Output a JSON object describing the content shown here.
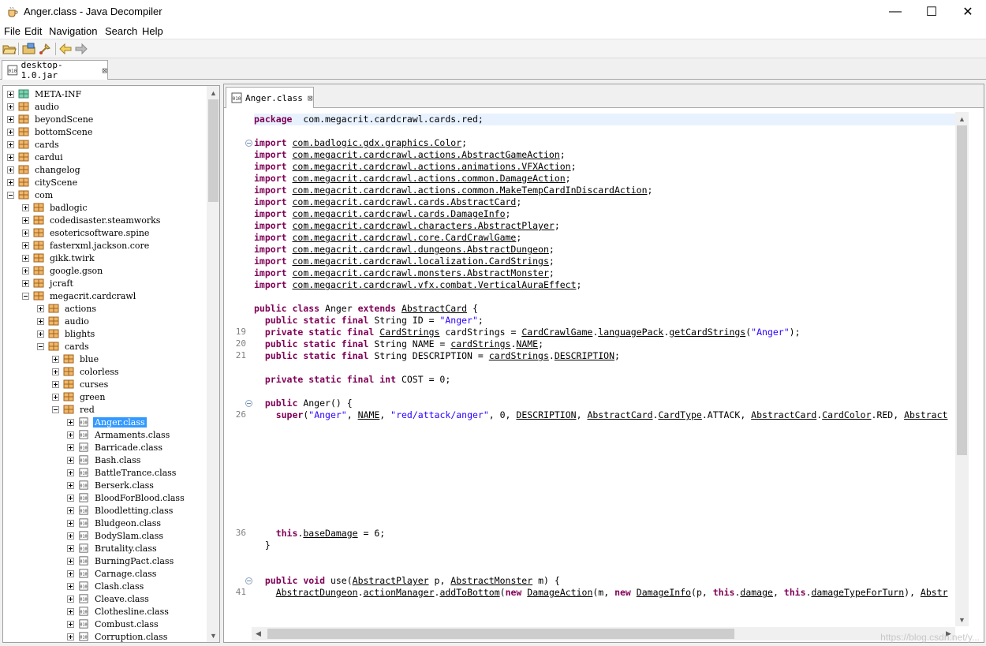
{
  "window": {
    "title": "Anger.class - Java Decompiler",
    "controls": {
      "minimize": "—",
      "maximize": "☐",
      "close": "✕"
    }
  },
  "menu": [
    "File",
    "Edit",
    "Navigation",
    "Search",
    "Help"
  ],
  "toolbar": [
    "open-file-icon",
    "open-folder-icon",
    "search-type-icon",
    "back-arrow-icon",
    "forward-arrow-icon"
  ],
  "outer_tab": {
    "label": "desktop-1.0.jar",
    "close": "⊠"
  },
  "editor_tab": {
    "label": "Anger.class",
    "close": "⊠"
  },
  "tree": [
    {
      "label": "META-INF",
      "indent": 0,
      "kind": "pkg-green",
      "exp": "plus"
    },
    {
      "label": "audio",
      "indent": 0,
      "kind": "pkg",
      "exp": "plus"
    },
    {
      "label": "beyondScene",
      "indent": 0,
      "kind": "pkg",
      "exp": "plus"
    },
    {
      "label": "bottomScene",
      "indent": 0,
      "kind": "pkg",
      "exp": "plus"
    },
    {
      "label": "cards",
      "indent": 0,
      "kind": "pkg",
      "exp": "plus"
    },
    {
      "label": "cardui",
      "indent": 0,
      "kind": "pkg",
      "exp": "plus"
    },
    {
      "label": "changelog",
      "indent": 0,
      "kind": "pkg",
      "exp": "plus"
    },
    {
      "label": "cityScene",
      "indent": 0,
      "kind": "pkg",
      "exp": "plus"
    },
    {
      "label": "com",
      "indent": 0,
      "kind": "pkg",
      "exp": "minus"
    },
    {
      "label": "badlogic",
      "indent": 1,
      "kind": "pkg",
      "exp": "plus"
    },
    {
      "label": "codedisaster.steamworks",
      "indent": 1,
      "kind": "pkg",
      "exp": "plus"
    },
    {
      "label": "esotericsoftware.spine",
      "indent": 1,
      "kind": "pkg",
      "exp": "plus"
    },
    {
      "label": "fasterxml.jackson.core",
      "indent": 1,
      "kind": "pkg",
      "exp": "plus"
    },
    {
      "label": "gikk.twirk",
      "indent": 1,
      "kind": "pkg",
      "exp": "plus"
    },
    {
      "label": "google.gson",
      "indent": 1,
      "kind": "pkg",
      "exp": "plus"
    },
    {
      "label": "jcraft",
      "indent": 1,
      "kind": "pkg",
      "exp": "plus"
    },
    {
      "label": "megacrit.cardcrawl",
      "indent": 1,
      "kind": "pkg",
      "exp": "minus"
    },
    {
      "label": "actions",
      "indent": 2,
      "kind": "pkg",
      "exp": "plus"
    },
    {
      "label": "audio",
      "indent": 2,
      "kind": "pkg",
      "exp": "plus"
    },
    {
      "label": "blights",
      "indent": 2,
      "kind": "pkg",
      "exp": "plus"
    },
    {
      "label": "cards",
      "indent": 2,
      "kind": "pkg",
      "exp": "minus"
    },
    {
      "label": "blue",
      "indent": 3,
      "kind": "pkg",
      "exp": "plus"
    },
    {
      "label": "colorless",
      "indent": 3,
      "kind": "pkg",
      "exp": "plus"
    },
    {
      "label": "curses",
      "indent": 3,
      "kind": "pkg",
      "exp": "plus"
    },
    {
      "label": "green",
      "indent": 3,
      "kind": "pkg",
      "exp": "plus"
    },
    {
      "label": "red",
      "indent": 3,
      "kind": "pkg",
      "exp": "minus"
    },
    {
      "label": "Anger.class",
      "indent": 4,
      "kind": "class",
      "exp": "plus",
      "selected": true
    },
    {
      "label": "Armaments.class",
      "indent": 4,
      "kind": "class",
      "exp": "plus"
    },
    {
      "label": "Barricade.class",
      "indent": 4,
      "kind": "class",
      "exp": "plus"
    },
    {
      "label": "Bash.class",
      "indent": 4,
      "kind": "class",
      "exp": "plus"
    },
    {
      "label": "BattleTrance.class",
      "indent": 4,
      "kind": "class",
      "exp": "plus"
    },
    {
      "label": "Berserk.class",
      "indent": 4,
      "kind": "class",
      "exp": "plus"
    },
    {
      "label": "BloodForBlood.class",
      "indent": 4,
      "kind": "class",
      "exp": "plus"
    },
    {
      "label": "Bloodletting.class",
      "indent": 4,
      "kind": "class",
      "exp": "plus"
    },
    {
      "label": "Bludgeon.class",
      "indent": 4,
      "kind": "class",
      "exp": "plus"
    },
    {
      "label": "BodySlam.class",
      "indent": 4,
      "kind": "class",
      "exp": "plus"
    },
    {
      "label": "Brutality.class",
      "indent": 4,
      "kind": "class",
      "exp": "plus"
    },
    {
      "label": "BurningPact.class",
      "indent": 4,
      "kind": "class",
      "exp": "plus"
    },
    {
      "label": "Carnage.class",
      "indent": 4,
      "kind": "class",
      "exp": "plus"
    },
    {
      "label": "Clash.class",
      "indent": 4,
      "kind": "class",
      "exp": "plus"
    },
    {
      "label": "Cleave.class",
      "indent": 4,
      "kind": "class",
      "exp": "plus"
    },
    {
      "label": "Clothesline.class",
      "indent": 4,
      "kind": "class",
      "exp": "plus"
    },
    {
      "label": "Combust.class",
      "indent": 4,
      "kind": "class",
      "exp": "plus"
    },
    {
      "label": "Corruption.class",
      "indent": 4,
      "kind": "class",
      "exp": "plus"
    }
  ],
  "code": [
    {
      "row": 0,
      "hl": true,
      "t": [
        [
          "kw",
          "package"
        ],
        [
          "",
          "  com.megacrit.cardcrawl.cards.red;"
        ]
      ]
    },
    {
      "row": 2,
      "fold": true,
      "t": [
        [
          "kw",
          "import"
        ],
        [
          "",
          " "
        ],
        [
          "u",
          "com.badlogic.gdx.graphics.Color"
        ],
        [
          "",
          ";"
        ]
      ]
    },
    {
      "row": 3,
      "t": [
        [
          "kw",
          "import"
        ],
        [
          "",
          " "
        ],
        [
          "u",
          "com.megacrit.cardcrawl.actions.AbstractGameAction"
        ],
        [
          "",
          ";"
        ]
      ]
    },
    {
      "row": 4,
      "t": [
        [
          "kw",
          "import"
        ],
        [
          "",
          " "
        ],
        [
          "u",
          "com.megacrit.cardcrawl.actions.animations.VFXAction"
        ],
        [
          "",
          ";"
        ]
      ]
    },
    {
      "row": 5,
      "t": [
        [
          "kw",
          "import"
        ],
        [
          "",
          " "
        ],
        [
          "u",
          "com.megacrit.cardcrawl.actions.common.DamageAction"
        ],
        [
          "",
          ";"
        ]
      ]
    },
    {
      "row": 6,
      "t": [
        [
          "kw",
          "import"
        ],
        [
          "",
          " "
        ],
        [
          "u",
          "com.megacrit.cardcrawl.actions.common.MakeTempCardInDiscardAction"
        ],
        [
          "",
          ";"
        ]
      ]
    },
    {
      "row": 7,
      "t": [
        [
          "kw",
          "import"
        ],
        [
          "",
          " "
        ],
        [
          "u",
          "com.megacrit.cardcrawl.cards.AbstractCard"
        ],
        [
          "",
          ";"
        ]
      ]
    },
    {
      "row": 8,
      "t": [
        [
          "kw",
          "import"
        ],
        [
          "",
          " "
        ],
        [
          "u",
          "com.megacrit.cardcrawl.cards.DamageInfo"
        ],
        [
          "",
          ";"
        ]
      ]
    },
    {
      "row": 9,
      "t": [
        [
          "kw",
          "import"
        ],
        [
          "",
          " "
        ],
        [
          "u",
          "com.megacrit.cardcrawl.characters.AbstractPlayer"
        ],
        [
          "",
          ";"
        ]
      ]
    },
    {
      "row": 10,
      "t": [
        [
          "kw",
          "import"
        ],
        [
          "",
          " "
        ],
        [
          "u",
          "com.megacrit.cardcrawl.core.CardCrawlGame"
        ],
        [
          "",
          ";"
        ]
      ]
    },
    {
      "row": 11,
      "t": [
        [
          "kw",
          "import"
        ],
        [
          "",
          " "
        ],
        [
          "u",
          "com.megacrit.cardcrawl.dungeons.AbstractDungeon"
        ],
        [
          "",
          ";"
        ]
      ]
    },
    {
      "row": 12,
      "t": [
        [
          "kw",
          "import"
        ],
        [
          "",
          " "
        ],
        [
          "u",
          "com.megacrit.cardcrawl.localization.CardStrings"
        ],
        [
          "",
          ";"
        ]
      ]
    },
    {
      "row": 13,
      "t": [
        [
          "kw",
          "import"
        ],
        [
          "",
          " "
        ],
        [
          "u",
          "com.megacrit.cardcrawl.monsters.AbstractMonster"
        ],
        [
          "",
          ";"
        ]
      ]
    },
    {
      "row": 14,
      "t": [
        [
          "kw",
          "import"
        ],
        [
          "",
          " "
        ],
        [
          "u",
          "com.megacrit.cardcrawl.vfx.combat.VerticalAuraEffect"
        ],
        [
          "",
          ";"
        ]
      ]
    },
    {
      "row": 16,
      "t": [
        [
          "kw",
          "public class"
        ],
        [
          "",
          " Anger "
        ],
        [
          "kw",
          "extends"
        ],
        [
          "",
          " "
        ],
        [
          "u",
          "AbstractCard"
        ],
        [
          "",
          " {"
        ]
      ]
    },
    {
      "row": 17,
      "t": [
        [
          "",
          "  "
        ],
        [
          "kw",
          "public static final"
        ],
        [
          "",
          " String ID = "
        ],
        [
          "st",
          "\"Anger\""
        ],
        [
          "",
          ";"
        ]
      ]
    },
    {
      "row": 18,
      "ln": "19",
      "t": [
        [
          "",
          "  "
        ],
        [
          "kw",
          "private static final"
        ],
        [
          "",
          " "
        ],
        [
          "u",
          "CardStrings"
        ],
        [
          "",
          " cardStrings = "
        ],
        [
          "u",
          "CardCrawlGame"
        ],
        [
          "",
          "."
        ],
        [
          "u",
          "languagePack"
        ],
        [
          "",
          "."
        ],
        [
          "u",
          "getCardStrings"
        ],
        [
          "",
          "("
        ],
        [
          "st",
          "\"Anger\""
        ],
        [
          "",
          ");"
        ]
      ]
    },
    {
      "row": 19,
      "ln": "20",
      "t": [
        [
          "",
          "  "
        ],
        [
          "kw",
          "public static final"
        ],
        [
          "",
          " String NAME = "
        ],
        [
          "u",
          "cardStrings"
        ],
        [
          "",
          "."
        ],
        [
          "u",
          "NAME"
        ],
        [
          "",
          ";"
        ]
      ]
    },
    {
      "row": 20,
      "ln": "21",
      "t": [
        [
          "",
          "  "
        ],
        [
          "kw",
          "public static final"
        ],
        [
          "",
          " String DESCRIPTION = "
        ],
        [
          "u",
          "cardStrings"
        ],
        [
          "",
          "."
        ],
        [
          "u",
          "DESCRIPTION"
        ],
        [
          "",
          ";"
        ]
      ]
    },
    {
      "row": 22,
      "t": [
        [
          "",
          "  "
        ],
        [
          "kw",
          "private static final int"
        ],
        [
          "",
          " COST = 0;"
        ]
      ]
    },
    {
      "row": 24,
      "fold": true,
      "t": [
        [
          "",
          "  "
        ],
        [
          "kw",
          "public"
        ],
        [
          "",
          " Anger() {"
        ]
      ]
    },
    {
      "row": 25,
      "ln": "26",
      "t": [
        [
          "",
          "    "
        ],
        [
          "kw",
          "super"
        ],
        [
          "",
          "("
        ],
        [
          "st",
          "\"Anger\""
        ],
        [
          "",
          ", "
        ],
        [
          "u",
          "NAME"
        ],
        [
          "",
          ", "
        ],
        [
          "st",
          "\"red/attack/anger\""
        ],
        [
          "",
          ", 0, "
        ],
        [
          "u",
          "DESCRIPTION"
        ],
        [
          "",
          ", "
        ],
        [
          "u",
          "AbstractCard"
        ],
        [
          "",
          "."
        ],
        [
          "u",
          "CardType"
        ],
        [
          "",
          ".ATTACK, "
        ],
        [
          "u",
          "AbstractCard"
        ],
        [
          "",
          "."
        ],
        [
          "u",
          "CardColor"
        ],
        [
          "",
          ".RED, "
        ],
        [
          "u",
          "Abstract"
        ]
      ]
    },
    {
      "row": 35,
      "ln": "36",
      "t": [
        [
          "",
          "    "
        ],
        [
          "kw",
          "this"
        ],
        [
          "",
          "."
        ],
        [
          "u",
          "baseDamage"
        ],
        [
          "",
          " = 6;"
        ]
      ]
    },
    {
      "row": 36,
      "t": [
        [
          "",
          "  }"
        ]
      ]
    },
    {
      "row": 39,
      "fold": true,
      "t": [
        [
          "",
          "  "
        ],
        [
          "kw",
          "public void"
        ],
        [
          "",
          " use("
        ],
        [
          "u",
          "AbstractPlayer"
        ],
        [
          "",
          " p, "
        ],
        [
          "u",
          "AbstractMonster"
        ],
        [
          "",
          " m) {"
        ]
      ]
    },
    {
      "row": 40,
      "ln": "41",
      "t": [
        [
          "",
          "    "
        ],
        [
          "u",
          "AbstractDungeon"
        ],
        [
          "",
          "."
        ],
        [
          "u",
          "actionManager"
        ],
        [
          "",
          "."
        ],
        [
          "u",
          "addToBottom"
        ],
        [
          "",
          "("
        ],
        [
          "kw",
          "new"
        ],
        [
          "",
          " "
        ],
        [
          "u",
          "DamageAction"
        ],
        [
          "",
          "(m, "
        ],
        [
          "kw",
          "new"
        ],
        [
          "",
          " "
        ],
        [
          "u",
          "DamageInfo"
        ],
        [
          "",
          "(p, "
        ],
        [
          "kw",
          "this"
        ],
        [
          "",
          "."
        ],
        [
          "u",
          "damage"
        ],
        [
          "",
          ", "
        ],
        [
          "kw",
          "this"
        ],
        [
          "",
          "."
        ],
        [
          "u",
          "damageTypeForTurn"
        ],
        [
          "",
          "), "
        ],
        [
          "u",
          "Abstr"
        ]
      ]
    }
  ],
  "watermark": "https://blog.csdn.net/y..."
}
